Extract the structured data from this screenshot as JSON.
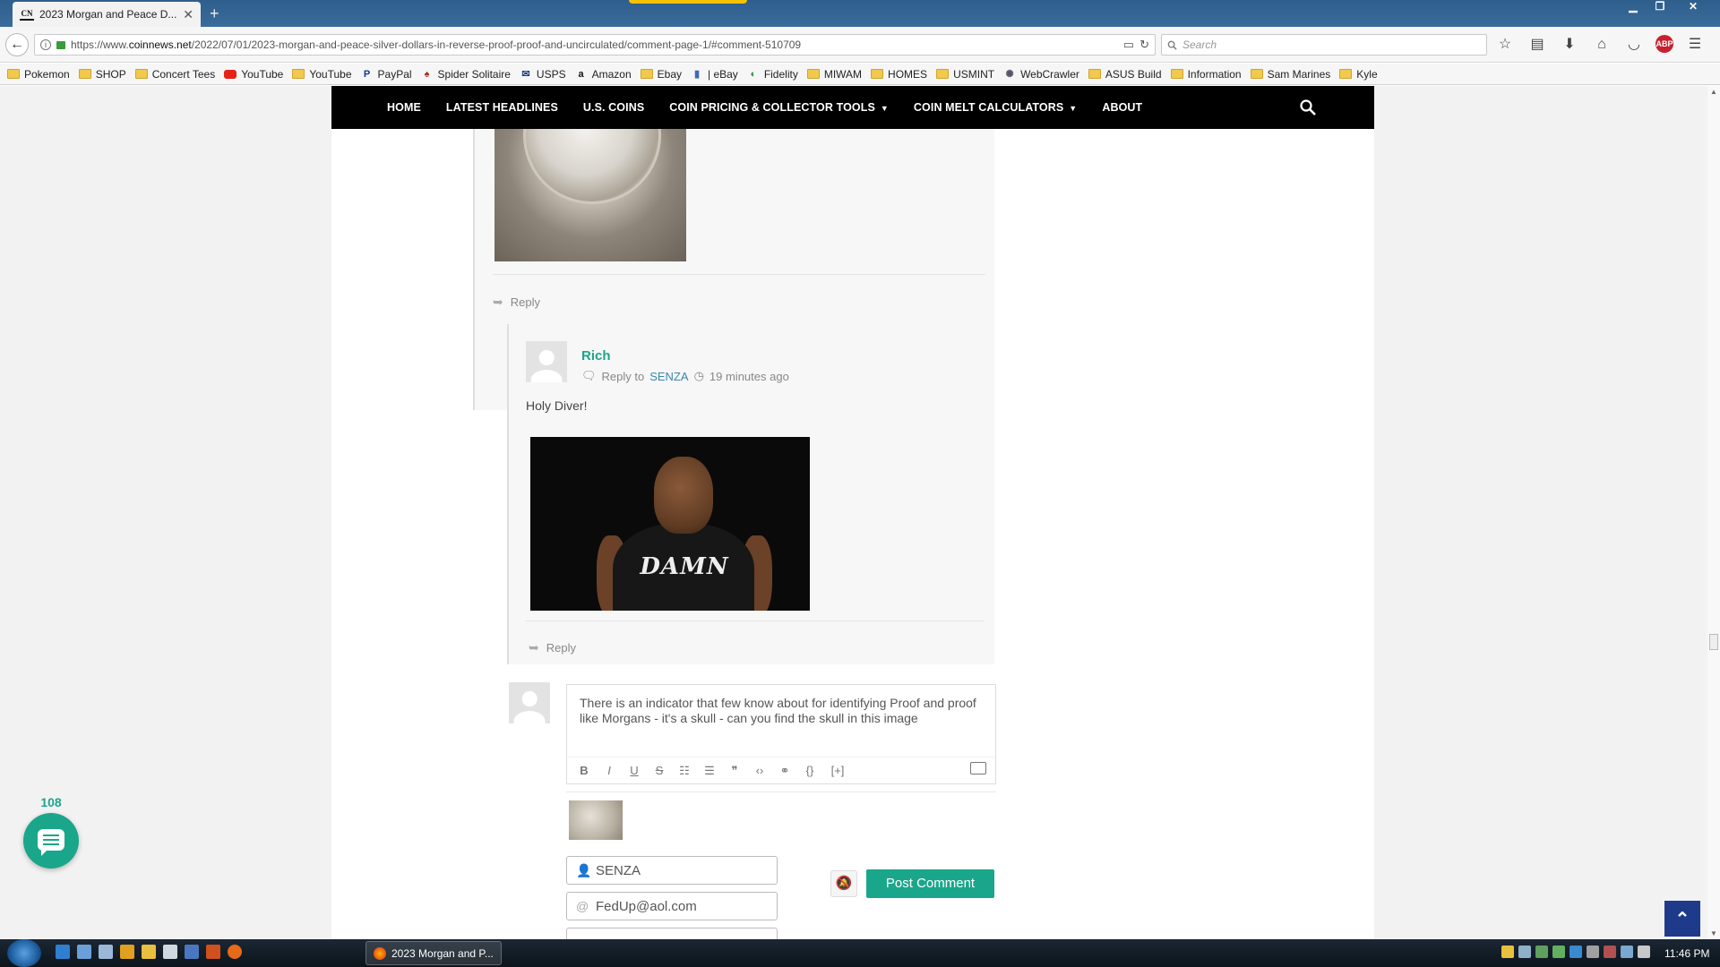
{
  "browser": {
    "tab_title": "2023 Morgan and Peace D...",
    "tab_favicon": "CN",
    "url_prefix": "https://www.",
    "url_domain": "coinnews.net",
    "url_path": "/2022/07/01/2023-morgan-and-peace-silver-dollars-in-reverse-proof-proof-and-uncirculated/comment-page-1/#comment-510709",
    "search_placeholder": "Search",
    "abp_badge": "ABP",
    "bookmarks": [
      {
        "label": "Pokemon",
        "icon": "folder"
      },
      {
        "label": "SHOP",
        "icon": "folder"
      },
      {
        "label": "Concert Tees",
        "icon": "folder"
      },
      {
        "label": "YouTube",
        "icon": "youtube"
      },
      {
        "label": "YouTube",
        "icon": "folder"
      },
      {
        "label": "PayPal",
        "icon": "paypal"
      },
      {
        "label": "Spider Solitaire",
        "icon": "spider"
      },
      {
        "label": "USPS",
        "icon": "usps"
      },
      {
        "label": "Amazon",
        "icon": "amazon"
      },
      {
        "label": "Ebay",
        "icon": "folder"
      },
      {
        "label": "| eBay",
        "icon": "ebay"
      },
      {
        "label": "Fidelity",
        "icon": "fidelity"
      },
      {
        "label": "MIWAM",
        "icon": "folder"
      },
      {
        "label": "HOMES",
        "icon": "folder"
      },
      {
        "label": "USMINT",
        "icon": "folder"
      },
      {
        "label": "WebCrawler",
        "icon": "webcrawler"
      },
      {
        "label": "ASUS Build",
        "icon": "folder"
      },
      {
        "label": "Information",
        "icon": "folder"
      },
      {
        "label": "Sam Marines",
        "icon": "folder"
      },
      {
        "label": "Kyle",
        "icon": "folder"
      }
    ]
  },
  "site_nav": {
    "home": "HOME",
    "latest": "LATEST HEADLINES",
    "us_coins": "U.S. COINS",
    "pricing": "COIN PRICING & COLLECTOR TOOLS",
    "melt": "COIN MELT CALCULATORS",
    "about": "ABOUT"
  },
  "comments": {
    "reply_label": "Reply",
    "rich": {
      "author": "Rich",
      "reply_to_label": "Reply to",
      "reply_to": "SENZA",
      "time": "19 minutes ago",
      "text": "Holy Diver!",
      "image_shirt_text": "DAMN"
    }
  },
  "form": {
    "draft": "There is an indicator that few know about for identifying Proof and proof like Morgans - it's a skull - can you find the skull in this image",
    "toolbar": [
      "B",
      "I",
      "U",
      "S",
      "ol",
      "ul",
      "quote",
      "code",
      "link",
      "{}",
      "[+]"
    ],
    "name_value": "SENZA",
    "email_value": "FedUp@aol.com",
    "post_button": "Post Comment"
  },
  "chat_count": "108",
  "taskbar": {
    "task_label": "2023 Morgan and P...",
    "clock": "11:46 PM"
  },
  "colors": {
    "accent": "#1aa68a",
    "nav_bg": "#000000",
    "scroll_top_bg": "#1e3a8a"
  }
}
